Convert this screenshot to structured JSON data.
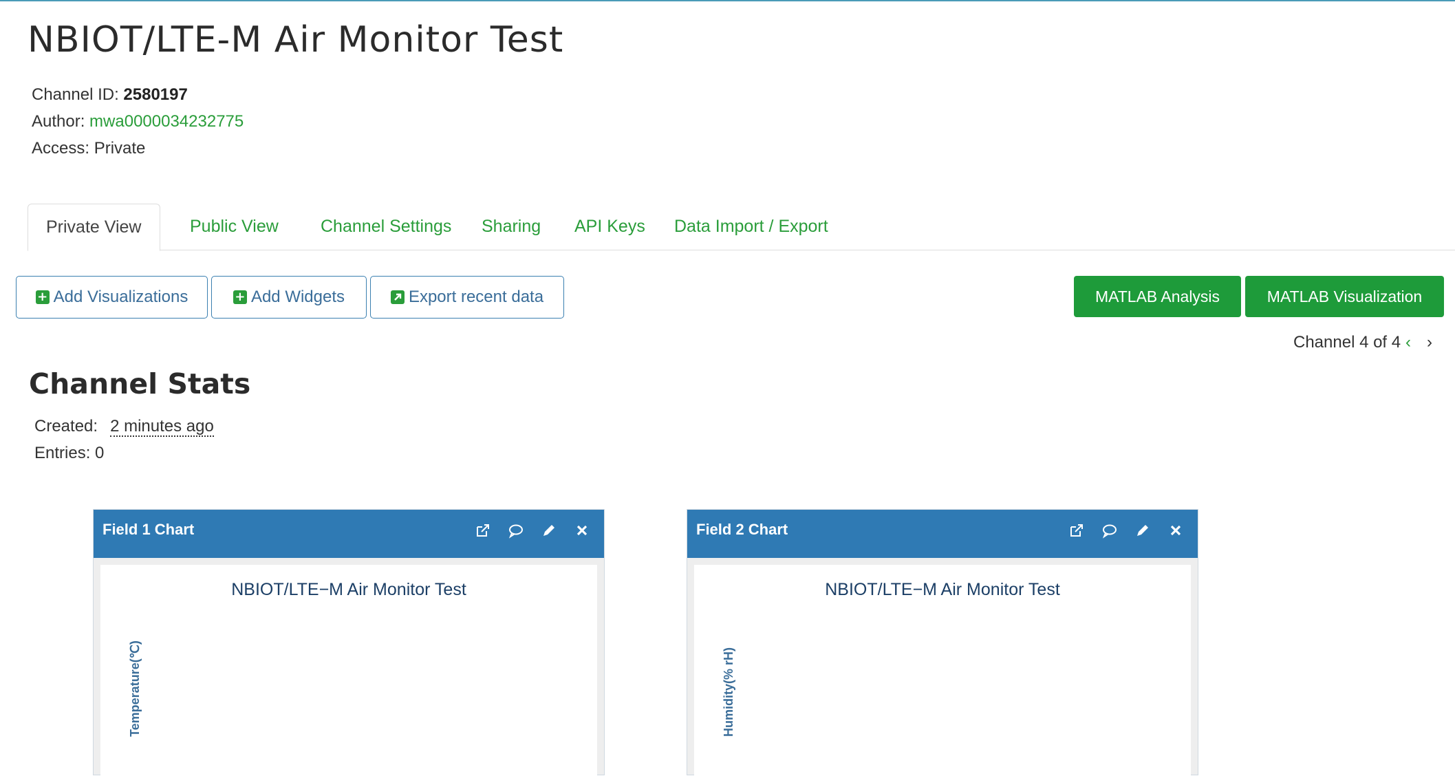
{
  "channel": {
    "title": "NBIOT/LTE-M Air Monitor Test",
    "id_label": "Channel ID: ",
    "id": "2580197",
    "author_label": "Author: ",
    "author": "mwa0000034232775",
    "access": "Access: Private"
  },
  "tabs": [
    {
      "label": "Private View"
    },
    {
      "label": "Public View"
    },
    {
      "label": "Channel Settings"
    },
    {
      "label": "Sharing"
    },
    {
      "label": "API Keys"
    },
    {
      "label": "Data Import / Export"
    }
  ],
  "toolbar": {
    "add_visualizations": "Add Visualizations",
    "add_widgets": "Add Widgets",
    "export_recent": "Export recent data",
    "matlab_analysis": "MATLAB Analysis",
    "matlab_visualization": "MATLAB Visualization"
  },
  "pager": {
    "text": "Channel 4 of 4",
    "prev": "‹",
    "next": "›"
  },
  "stats": {
    "heading": "Channel Stats",
    "created_label": "Created:",
    "created_value": "2 minutes ago",
    "entries": "Entries: 0"
  },
  "charts": [
    {
      "panel_title": "Field 1 Chart",
      "chart_title": "NBIOT/LTE−M Air Monitor Test",
      "ylabel": "Temperature(℃)"
    },
    {
      "panel_title": "Field 2 Chart",
      "chart_title": "NBIOT/LTE−M Air Monitor Test",
      "ylabel": "Humidity(% rH)"
    }
  ],
  "colors": {
    "accent_green": "#2a9d3a",
    "button_green": "#1e9b3a",
    "panel_blue": "#2f7ab4",
    "outline_blue": "#3a7fb0"
  },
  "icons": [
    "open-external-icon",
    "comment-icon",
    "pencil-icon",
    "close-icon"
  ]
}
